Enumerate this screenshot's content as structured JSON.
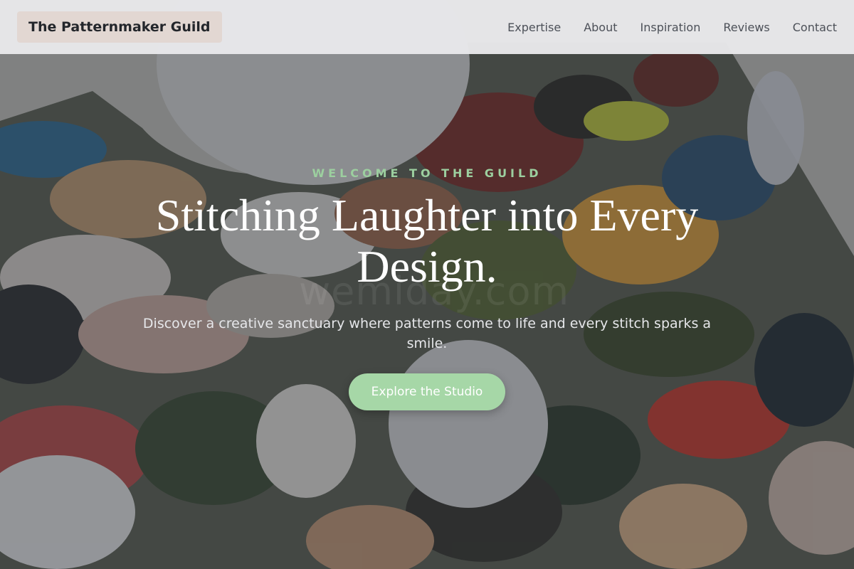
{
  "header": {
    "brand": "The Patternmaker Guild",
    "nav": [
      "Expertise",
      "About",
      "Inspiration",
      "Reviews",
      "Contact"
    ]
  },
  "hero": {
    "eyebrow": "WELCOME TO THE GUILD",
    "headline": "Stitching Laughter into Every Design.",
    "lede": "Discover a creative sanctuary where patterns come to life and every stitch sparks a smile.",
    "cta_label": "Explore the Studio",
    "watermark": "wemiday.com",
    "background": "paint-palette-image"
  },
  "colors": {
    "accent": "#a6d7a7",
    "eyebrow": "#9ccf9f",
    "header_bg": "#e8e8ea",
    "brand_bg": "#e2d7d2"
  }
}
